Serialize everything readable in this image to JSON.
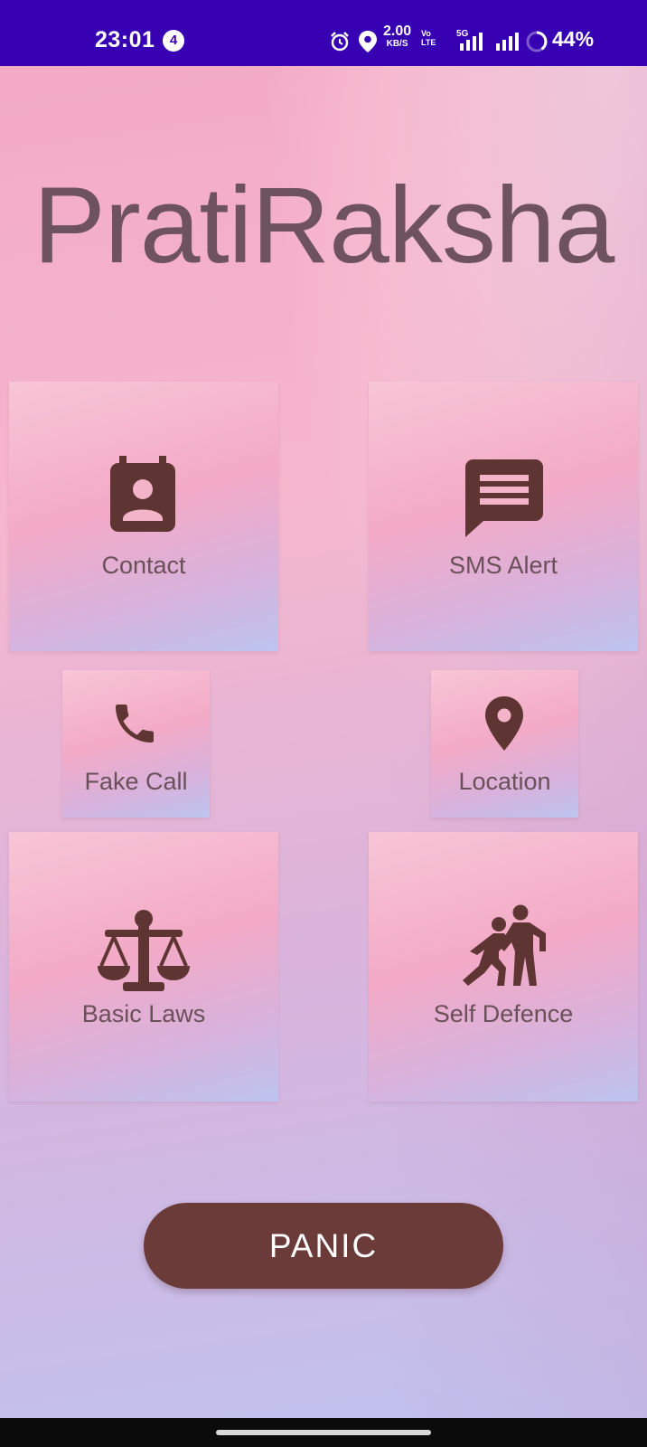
{
  "status_bar": {
    "time": "23:01",
    "notification_count": "4",
    "net_speed": "2.00",
    "net_speed_unit": "KB/S",
    "volte_line1": "Vo",
    "volte_line2": "LTE",
    "network": "5G",
    "battery_percent": "44%",
    "icons": [
      "alarm-icon",
      "location-icon",
      "signal-icon",
      "signal-icon",
      "battery-ring-icon"
    ],
    "color": "#3700b3"
  },
  "app": {
    "title": "PratiRaksha"
  },
  "tiles": {
    "contact": {
      "label": "Contact",
      "icon": "contact-card-icon"
    },
    "sms_alert": {
      "label": "SMS Alert",
      "icon": "message-icon"
    },
    "fake_call": {
      "label": "Fake Call",
      "icon": "phone-icon"
    },
    "location": {
      "label": "Location",
      "icon": "map-pin-icon"
    },
    "basic_laws": {
      "label": "Basic Laws",
      "icon": "scales-icon"
    },
    "self_defence": {
      "label": "Self Defence",
      "icon": "self-defence-icon"
    }
  },
  "panic_button": {
    "label": "PANIC",
    "color": "#6b3b39"
  },
  "colors": {
    "icon": "#5e3533",
    "label": "#6a5058",
    "title": "#6e535e"
  }
}
